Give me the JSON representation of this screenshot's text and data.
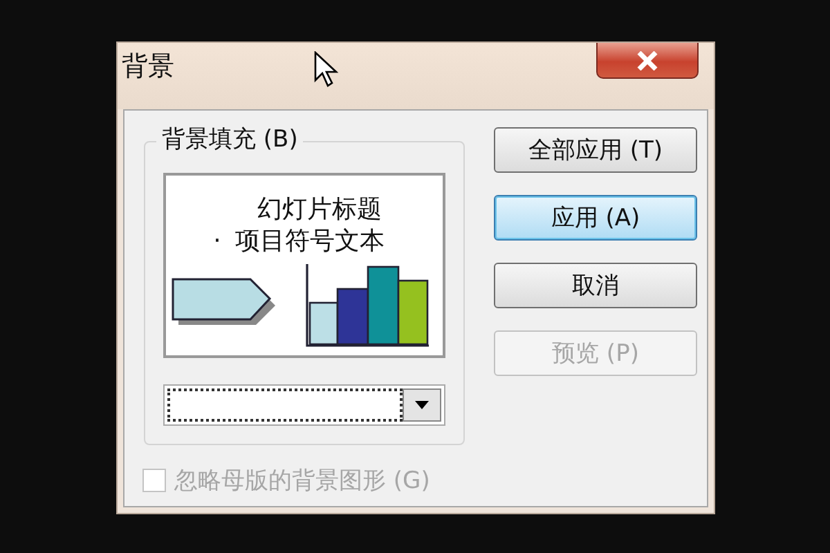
{
  "window": {
    "title": "背景"
  },
  "fill_group": {
    "label": "背景填充 (B)",
    "preview": {
      "title": "幻灯片标题",
      "bullet": "·",
      "bullet_text": "项目符号文本"
    },
    "dropdown": {
      "focused": true
    }
  },
  "buttons": [
    {
      "label": "全部应用 (T)",
      "default": false,
      "disabled": false
    },
    {
      "label": "应用 (A)",
      "default": true,
      "disabled": false
    },
    {
      "label": "取消",
      "default": false,
      "disabled": false
    },
    {
      "label": "预览 (P)",
      "default": false,
      "disabled": true
    }
  ],
  "checkbox": {
    "label": "忽略母版的背景图形 (G)",
    "checked": false,
    "disabled": true
  }
}
